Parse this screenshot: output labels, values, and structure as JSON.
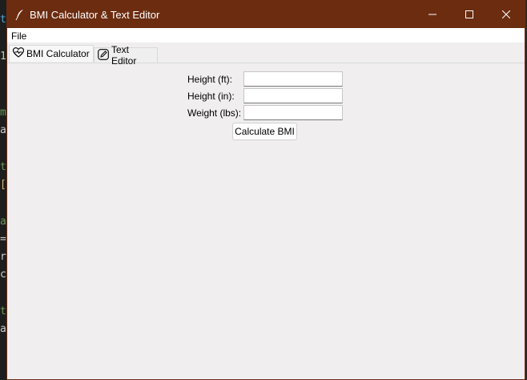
{
  "window": {
    "title": "BMI Calculator & Text Editor",
    "titlebar_color": "#6b2c10",
    "controls": {
      "minimize": "minimize-icon",
      "maximize": "maximize-icon",
      "close": "close-icon"
    }
  },
  "menubar": {
    "items": [
      {
        "label": "File"
      }
    ]
  },
  "tabs": [
    {
      "label": "BMI Calculator",
      "icon": "heart-pulse-icon",
      "active": true
    },
    {
      "label": "Text Editor",
      "icon": "edit-icon",
      "active": false
    }
  ],
  "form": {
    "height_ft": {
      "label": "Height (ft):",
      "value": ""
    },
    "height_in": {
      "label": "Height (in):",
      "value": ""
    },
    "weight_lbs": {
      "label": "Weight (lbs):",
      "value": ""
    },
    "calculate_label": "Calculate BMI"
  }
}
